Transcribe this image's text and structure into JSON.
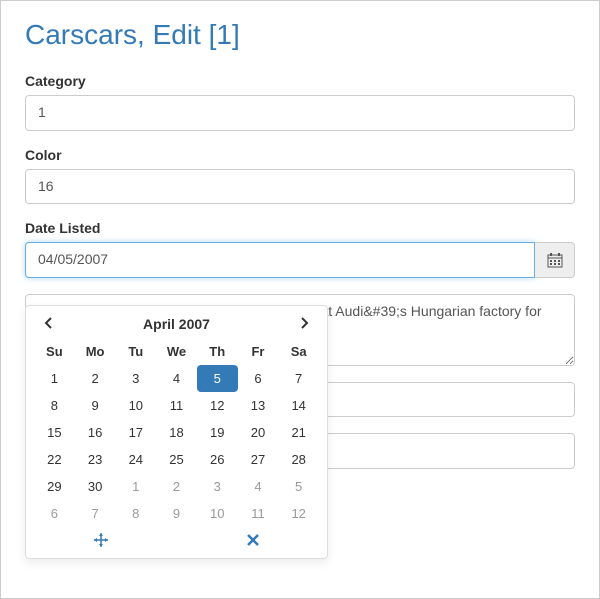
{
  "page_title": "Carscars, Edit [1]",
  "form": {
    "category": {
      "label": "Category",
      "value": "1"
    },
    "color": {
      "label": "Color",
      "value": "16"
    },
    "date_listed": {
      "label": "Date Listed",
      "value": "04/05/2007"
    },
    "description_value": "diary Audi Hungaria Motor Kft. in and painted at Audi&#39;s Hungarian factory for the third "
  },
  "datepicker": {
    "title": "April 2007",
    "dow": [
      "Su",
      "Mo",
      "Tu",
      "We",
      "Th",
      "Fr",
      "Sa"
    ],
    "weeks": [
      [
        {
          "d": 1
        },
        {
          "d": 2
        },
        {
          "d": 3
        },
        {
          "d": 4
        },
        {
          "d": 5,
          "selected": true
        },
        {
          "d": 6
        },
        {
          "d": 7
        }
      ],
      [
        {
          "d": 8
        },
        {
          "d": 9
        },
        {
          "d": 10
        },
        {
          "d": 11
        },
        {
          "d": 12
        },
        {
          "d": 13
        },
        {
          "d": 14
        }
      ],
      [
        {
          "d": 15
        },
        {
          "d": 16
        },
        {
          "d": 17
        },
        {
          "d": 18
        },
        {
          "d": 19
        },
        {
          "d": 20
        },
        {
          "d": 21
        }
      ],
      [
        {
          "d": 22
        },
        {
          "d": 23
        },
        {
          "d": 24
        },
        {
          "d": 25
        },
        {
          "d": 26
        },
        {
          "d": 27
        },
        {
          "d": 28
        }
      ],
      [
        {
          "d": 29
        },
        {
          "d": 30
        },
        {
          "d": 1,
          "muted": true
        },
        {
          "d": 2,
          "muted": true
        },
        {
          "d": 3,
          "muted": true
        },
        {
          "d": 4,
          "muted": true
        },
        {
          "d": 5,
          "muted": true
        }
      ],
      [
        {
          "d": 6,
          "muted": true
        },
        {
          "d": 7,
          "muted": true
        },
        {
          "d": 8,
          "muted": true
        },
        {
          "d": 9,
          "muted": true
        },
        {
          "d": 10,
          "muted": true
        },
        {
          "d": 11,
          "muted": true
        },
        {
          "d": 12,
          "muted": true
        }
      ]
    ]
  },
  "icons": {
    "prev": "‹",
    "next": "›",
    "today": "✥",
    "clear": "✖"
  }
}
